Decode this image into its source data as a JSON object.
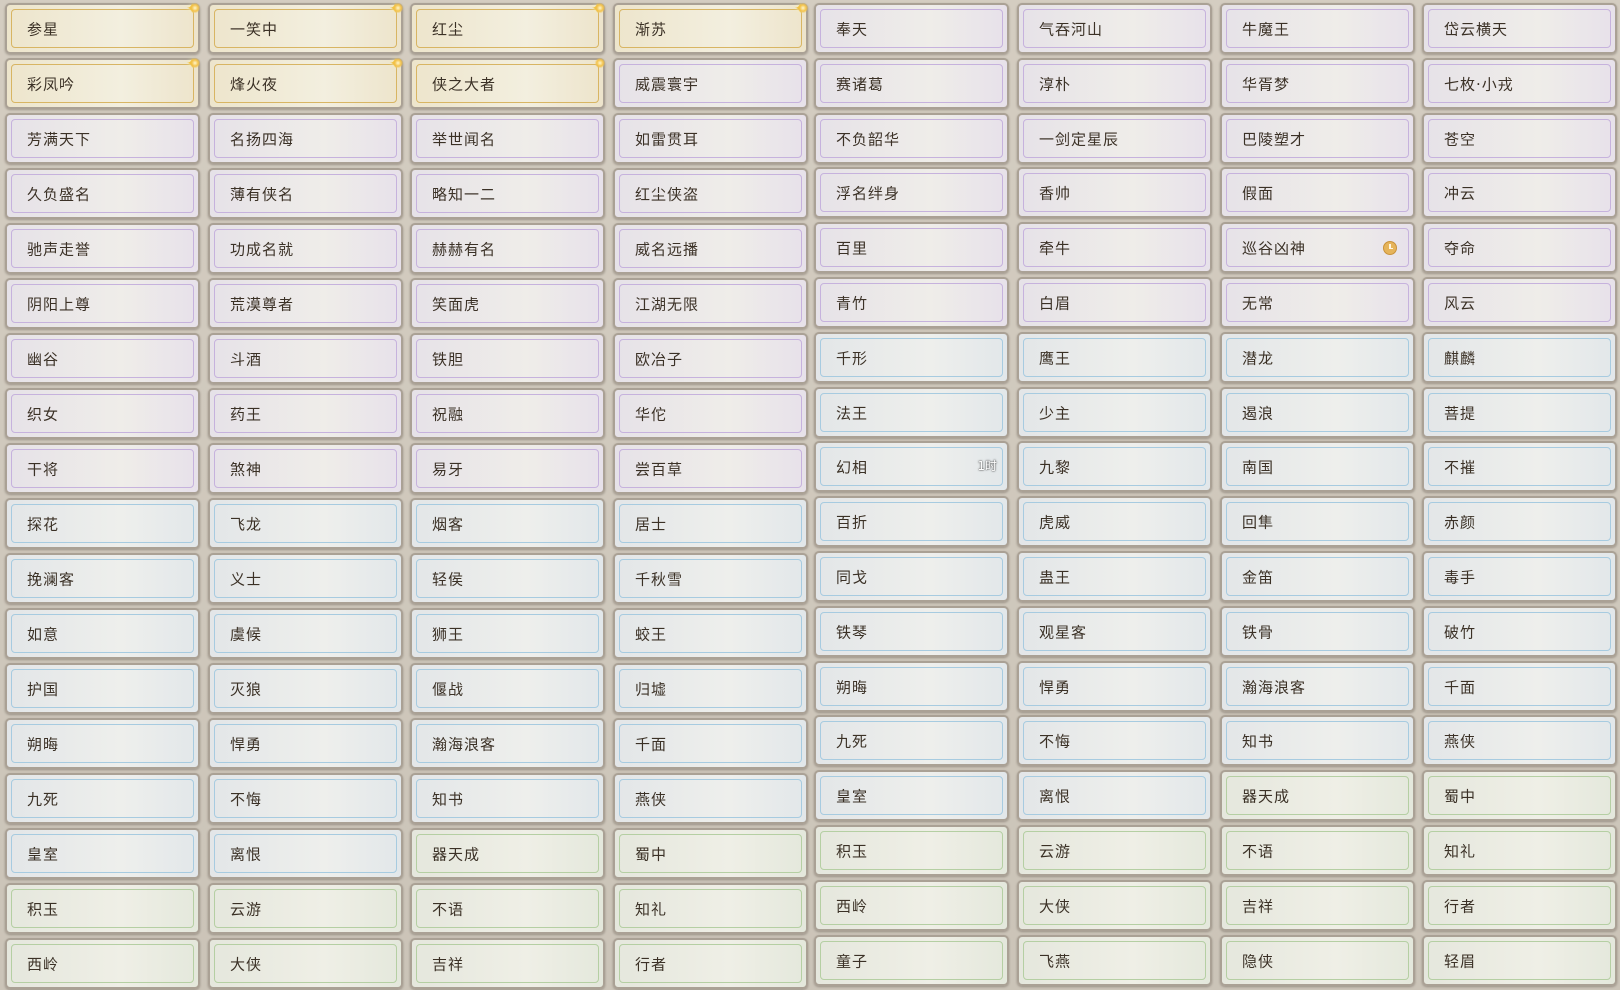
{
  "columns": [
    {
      "items": [
        {
          "label": "参星",
          "rarity": "gold",
          "sparkle": true
        },
        {
          "label": "彩凤吟",
          "rarity": "gold",
          "sparkle": true
        },
        {
          "label": "芳满天下",
          "rarity": "purple"
        },
        {
          "label": "久负盛名",
          "rarity": "purple"
        },
        {
          "label": "驰声走誉",
          "rarity": "purple"
        },
        {
          "label": "阴阳上尊",
          "rarity": "purple"
        },
        {
          "label": "幽谷",
          "rarity": "purple"
        },
        {
          "label": "织女",
          "rarity": "purple"
        },
        {
          "label": "干将",
          "rarity": "purple"
        },
        {
          "label": "探花",
          "rarity": "blue"
        },
        {
          "label": "挽澜客",
          "rarity": "blue"
        },
        {
          "label": "如意",
          "rarity": "blue"
        },
        {
          "label": "护国",
          "rarity": "blue"
        },
        {
          "label": "朔晦",
          "rarity": "blue"
        },
        {
          "label": "九死",
          "rarity": "blue"
        },
        {
          "label": "皇室",
          "rarity": "blue"
        },
        {
          "label": "积玉",
          "rarity": "green"
        },
        {
          "label": "西岭",
          "rarity": "green"
        }
      ]
    },
    {
      "items": [
        {
          "label": "一笑中",
          "rarity": "gold",
          "sparkle": true
        },
        {
          "label": "烽火夜",
          "rarity": "gold",
          "sparkle": true
        },
        {
          "label": "名扬四海",
          "rarity": "purple"
        },
        {
          "label": "薄有侠名",
          "rarity": "purple"
        },
        {
          "label": "功成名就",
          "rarity": "purple"
        },
        {
          "label": "荒漠尊者",
          "rarity": "purple"
        },
        {
          "label": "斗酒",
          "rarity": "purple"
        },
        {
          "label": "药王",
          "rarity": "purple"
        },
        {
          "label": "煞神",
          "rarity": "purple"
        },
        {
          "label": "飞龙",
          "rarity": "blue"
        },
        {
          "label": "义士",
          "rarity": "blue"
        },
        {
          "label": "虞候",
          "rarity": "blue"
        },
        {
          "label": "灭狼",
          "rarity": "blue"
        },
        {
          "label": "悍勇",
          "rarity": "blue"
        },
        {
          "label": "不悔",
          "rarity": "blue"
        },
        {
          "label": "离恨",
          "rarity": "blue"
        },
        {
          "label": "云游",
          "rarity": "green"
        },
        {
          "label": "大侠",
          "rarity": "green"
        }
      ]
    },
    {
      "items": [
        {
          "label": "红尘",
          "rarity": "gold",
          "sparkle": true
        },
        {
          "label": "侠之大者",
          "rarity": "gold"
        },
        {
          "label": "举世闻名",
          "rarity": "purple"
        },
        {
          "label": "略知一二",
          "rarity": "purple"
        },
        {
          "label": "赫赫有名",
          "rarity": "purple"
        },
        {
          "label": "笑面虎",
          "rarity": "purple"
        },
        {
          "label": "铁胆",
          "rarity": "purple"
        },
        {
          "label": "祝融",
          "rarity": "purple"
        },
        {
          "label": "易牙",
          "rarity": "purple"
        },
        {
          "label": "烟客",
          "rarity": "blue"
        },
        {
          "label": "轻侯",
          "rarity": "blue"
        },
        {
          "label": "狮王",
          "rarity": "blue"
        },
        {
          "label": "偃战",
          "rarity": "blue"
        },
        {
          "label": "瀚海浪客",
          "rarity": "blue"
        },
        {
          "label": "知书",
          "rarity": "blue"
        },
        {
          "label": "器天成",
          "rarity": "green"
        },
        {
          "label": "不语",
          "rarity": "green"
        },
        {
          "label": "吉祥",
          "rarity": "green"
        }
      ]
    },
    {
      "items": [
        {
          "label": "渐苏",
          "rarity": "gold",
          "sparkle": true
        },
        {
          "label": "威震寰宇",
          "rarity": "purple"
        },
        {
          "label": "如雷贯耳",
          "rarity": "purple"
        },
        {
          "label": "红尘侠盗",
          "rarity": "purple"
        },
        {
          "label": "威名远播",
          "rarity": "purple"
        },
        {
          "label": "江湖无限",
          "rarity": "purple"
        },
        {
          "label": "欧冶子",
          "rarity": "purple"
        },
        {
          "label": "华佗",
          "rarity": "purple"
        },
        {
          "label": "尝百草",
          "rarity": "purple"
        },
        {
          "label": "居士",
          "rarity": "blue"
        },
        {
          "label": "千秋雪",
          "rarity": "blue"
        },
        {
          "label": "蛟王",
          "rarity": "blue"
        },
        {
          "label": "归墟",
          "rarity": "blue"
        },
        {
          "label": "千面",
          "rarity": "blue"
        },
        {
          "label": "燕侠",
          "rarity": "blue"
        },
        {
          "label": "蜀中",
          "rarity": "green"
        },
        {
          "label": "知礼",
          "rarity": "green"
        },
        {
          "label": "行者",
          "rarity": "green"
        }
      ]
    },
    {
      "items": [
        {
          "label": "奉天",
          "rarity": "purple"
        },
        {
          "label": "赛诸葛",
          "rarity": "purple"
        },
        {
          "label": "不负韶华",
          "rarity": "purple"
        },
        {
          "label": "浮名绊身",
          "rarity": "purple"
        },
        {
          "label": "百里",
          "rarity": "purple"
        },
        {
          "label": "青竹",
          "rarity": "purple"
        },
        {
          "label": "千形",
          "rarity": "blue"
        },
        {
          "label": "法王",
          "rarity": "blue"
        },
        {
          "label": "幻相",
          "rarity": "blue",
          "badge": "1时"
        },
        {
          "label": "百折",
          "rarity": "blue"
        },
        {
          "label": "同戈",
          "rarity": "blue"
        },
        {
          "label": "铁琴",
          "rarity": "blue"
        },
        {
          "label": "朔晦",
          "rarity": "blue"
        },
        {
          "label": "九死",
          "rarity": "blue"
        },
        {
          "label": "皇室",
          "rarity": "blue"
        },
        {
          "label": "积玉",
          "rarity": "green"
        },
        {
          "label": "西岭",
          "rarity": "green"
        },
        {
          "label": "童子",
          "rarity": "green"
        }
      ]
    },
    {
      "items": [
        {
          "label": "气吞河山",
          "rarity": "purple"
        },
        {
          "label": "淳朴",
          "rarity": "purple"
        },
        {
          "label": "一剑定星辰",
          "rarity": "purple"
        },
        {
          "label": "香帅",
          "rarity": "purple"
        },
        {
          "label": "牵牛",
          "rarity": "purple"
        },
        {
          "label": "白眉",
          "rarity": "purple"
        },
        {
          "label": "鹰王",
          "rarity": "blue"
        },
        {
          "label": "少主",
          "rarity": "blue"
        },
        {
          "label": "九黎",
          "rarity": "blue"
        },
        {
          "label": "虎威",
          "rarity": "blue"
        },
        {
          "label": "蛊王",
          "rarity": "blue"
        },
        {
          "label": "观星客",
          "rarity": "blue"
        },
        {
          "label": "悍勇",
          "rarity": "blue"
        },
        {
          "label": "不悔",
          "rarity": "blue"
        },
        {
          "label": "离恨",
          "rarity": "blue"
        },
        {
          "label": "云游",
          "rarity": "green"
        },
        {
          "label": "大侠",
          "rarity": "green"
        },
        {
          "label": "飞燕",
          "rarity": "green"
        }
      ]
    },
    {
      "items": [
        {
          "label": "牛魔王",
          "rarity": "purple"
        },
        {
          "label": "华胥梦",
          "rarity": "purple"
        },
        {
          "label": "巴陵塑才",
          "rarity": "purple"
        },
        {
          "label": "假面",
          "rarity": "purple"
        },
        {
          "label": "巡谷凶神",
          "rarity": "purple",
          "clock": true
        },
        {
          "label": "无常",
          "rarity": "purple"
        },
        {
          "label": "潜龙",
          "rarity": "blue"
        },
        {
          "label": "遏浪",
          "rarity": "blue"
        },
        {
          "label": "南国",
          "rarity": "blue"
        },
        {
          "label": "回隼",
          "rarity": "blue"
        },
        {
          "label": "金笛",
          "rarity": "blue"
        },
        {
          "label": "铁骨",
          "rarity": "blue"
        },
        {
          "label": "瀚海浪客",
          "rarity": "blue"
        },
        {
          "label": "知书",
          "rarity": "blue"
        },
        {
          "label": "器天成",
          "rarity": "green"
        },
        {
          "label": "不语",
          "rarity": "green"
        },
        {
          "label": "吉祥",
          "rarity": "green"
        },
        {
          "label": "隐侠",
          "rarity": "green"
        }
      ]
    },
    {
      "items": [
        {
          "label": "岱云横天",
          "rarity": "purple"
        },
        {
          "label": "七枚·小戎",
          "rarity": "purple"
        },
        {
          "label": "苍空",
          "rarity": "purple"
        },
        {
          "label": "冲云",
          "rarity": "purple"
        },
        {
          "label": "夺命",
          "rarity": "purple"
        },
        {
          "label": "风云",
          "rarity": "purple"
        },
        {
          "label": "麒麟",
          "rarity": "blue"
        },
        {
          "label": "菩提",
          "rarity": "blue"
        },
        {
          "label": "不摧",
          "rarity": "blue"
        },
        {
          "label": "赤颜",
          "rarity": "blue"
        },
        {
          "label": "毒手",
          "rarity": "blue"
        },
        {
          "label": "破竹",
          "rarity": "blue"
        },
        {
          "label": "千面",
          "rarity": "blue"
        },
        {
          "label": "燕侠",
          "rarity": "blue"
        },
        {
          "label": "蜀中",
          "rarity": "green"
        },
        {
          "label": "知礼",
          "rarity": "green"
        },
        {
          "label": "行者",
          "rarity": "green"
        },
        {
          "label": "轻眉",
          "rarity": "green"
        }
      ]
    }
  ]
}
